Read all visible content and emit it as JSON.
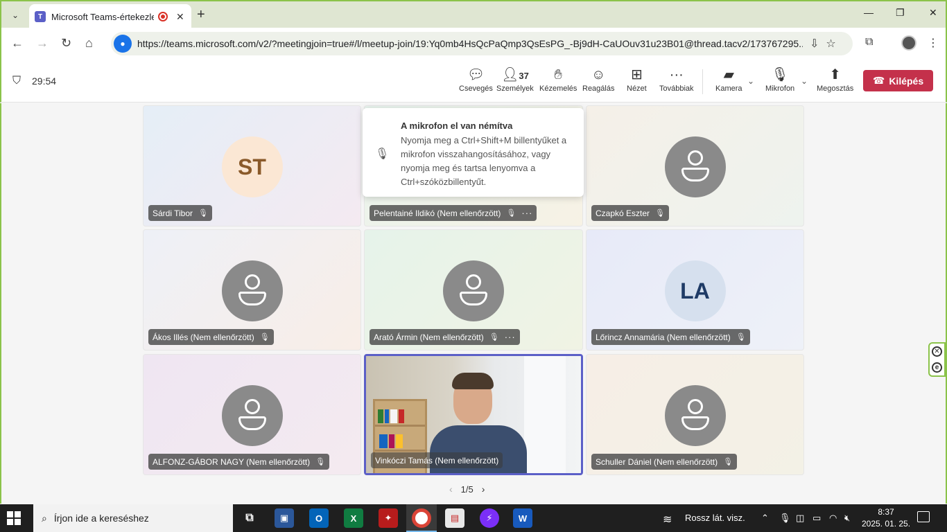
{
  "browser": {
    "tab_title": "Microsoft Teams-értekezlet",
    "favicon_letter": "T",
    "url": "https://teams.microsoft.com/v2/?meetingjoin=true#/l/meetup-join/19:Yq0mb4HsQcPaQmp3QsEsPG_-Bj9dH-CaUOuv31u23B01@thread.tacv2/173767295..."
  },
  "meeting": {
    "timer": "29:54",
    "toolbar": {
      "chat": "Csevegés",
      "people": "Személyek",
      "people_count": "37",
      "raise_hand": "Kézemelés",
      "react": "Reagálás",
      "view": "Nézet",
      "more": "Továbbiak",
      "camera": "Kamera",
      "mic": "Mikrofon",
      "share": "Megosztás",
      "leave": "Kilépés"
    },
    "toast": {
      "title": "A mikrofon el van némítva",
      "body": "Nyomja meg a Ctrl+Shift+M billentyűket a mikrofon visszahangosításához, vagy nyomja meg és tartsa lenyomva a Ctrl+szóközbillentyűt."
    },
    "participants": [
      {
        "name": "Sárdi Tibor",
        "initials": "ST"
      },
      {
        "name": "Pelentainé Ildikó (Nem ellenőrzött)"
      },
      {
        "name": "Czapkó Eszter"
      },
      {
        "name": "Ákos Illés (Nem ellenőrzött)"
      },
      {
        "name": "Arató Ármin (Nem ellenőrzött)"
      },
      {
        "name": "Lőrincz Annamária (Nem ellenőrzött)",
        "initials": "LA"
      },
      {
        "name": "ALFONZ-GÁBOR NAGY (Nem ellenőrzött)"
      },
      {
        "name": "Vinkóczi Tamás (Nem ellenőrzött)"
      },
      {
        "name": "Schuller Dániel (Nem ellenőrzött)"
      }
    ],
    "pager": "1/5"
  },
  "taskbar": {
    "search_placeholder": "Írjon ide a kereséshez",
    "weather": "Rossz lát. visz.",
    "time": "8:37",
    "date": "2025. 01. 25."
  },
  "colors": {
    "leave_button": "#c4314b",
    "accent": "#5b5fc7",
    "active_tile_border": "#5b5fc7"
  }
}
